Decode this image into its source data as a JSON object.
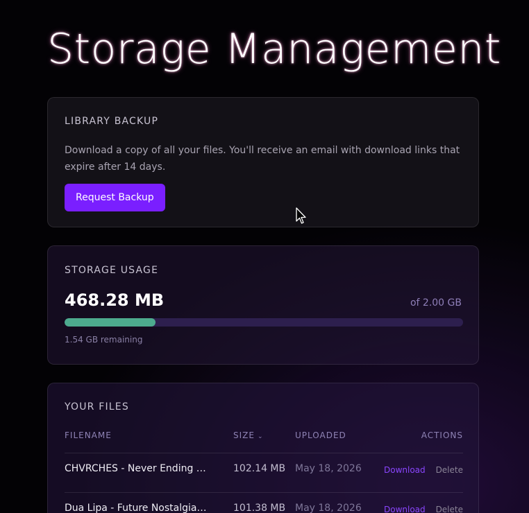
{
  "page": {
    "title": "Storage Management"
  },
  "backup": {
    "heading": "LIBRARY BACKUP",
    "description": "Download a copy of all your files. You'll receive an email with download links that expire after 14 days.",
    "button_label": "Request Backup"
  },
  "usage": {
    "heading": "STORAGE USAGE",
    "used": "468.28 MB",
    "total": "of 2.00 GB",
    "remaining": "1.54 GB remaining",
    "used_fraction": 0.2287
  },
  "files": {
    "heading": "YOUR FILES",
    "columns": {
      "filename": "FILENAME",
      "size": "SIZE",
      "uploaded": "UPLOADED",
      "actions": "ACTIONS"
    },
    "sort_icon": "chevron-down-icon",
    "rows": [
      {
        "name": "CHVRCHES - Never Ending Cir...",
        "size": "102.14 MB",
        "uploaded": "May 18, 2026",
        "download": "Download",
        "delete": "Delete"
      },
      {
        "name": "Dua Lipa - Future Nostalgia....",
        "size": "101.38 MB",
        "uploaded": "May 18, 2026",
        "download": "Download",
        "delete": "Delete"
      }
    ]
  },
  "colors": {
    "accent": "#7a1fff",
    "progress_fill": "#4dab8e",
    "progress_track": "#2d1f4e",
    "link": "#8b46ff"
  }
}
